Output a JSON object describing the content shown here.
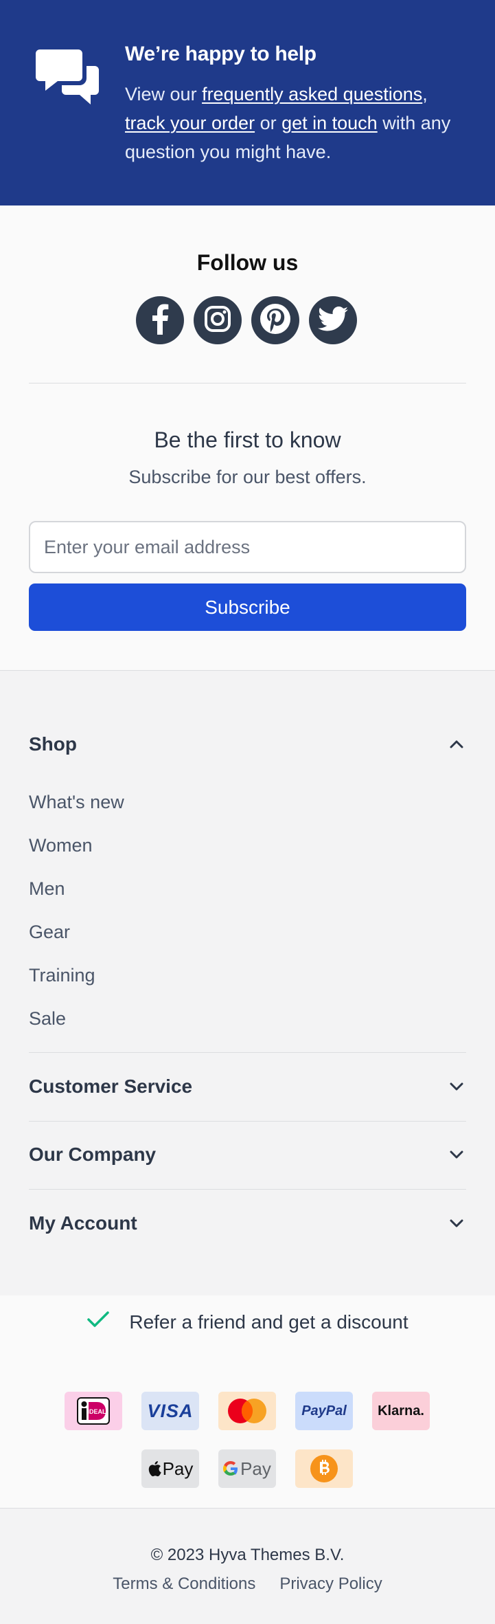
{
  "help": {
    "title": "We’re happy to help",
    "text_1": "View our ",
    "link_faq": "frequently asked questions",
    "text_2": ", ",
    "link_track": "track your order",
    "text_3": " or ",
    "link_contact": "get in touch",
    "text_4": " with any question you might have."
  },
  "follow": {
    "title": "Follow us",
    "icons": [
      "facebook-icon",
      "instagram-icon",
      "pinterest-icon",
      "twitter-icon"
    ]
  },
  "newsletter": {
    "title": "Be the first to know",
    "subtitle": "Subscribe for our best offers.",
    "email_placeholder": "Enter your email address",
    "email_value": "",
    "button": "Subscribe"
  },
  "footer_links": {
    "shop": {
      "title": "Shop",
      "expanded": true,
      "items": [
        "What's new",
        "Women",
        "Men",
        "Gear",
        "Training",
        "Sale"
      ]
    },
    "customer_service": {
      "title": "Customer Service",
      "expanded": false
    },
    "our_company": {
      "title": "Our Company",
      "expanded": false
    },
    "my_account": {
      "title": "My Account",
      "expanded": false
    }
  },
  "refer": {
    "text": "Refer a friend and get a discount"
  },
  "payments": {
    "ideal": "iDEAL",
    "visa": "VISA",
    "paypal": "PayPal",
    "klarna": "Klarna.",
    "applepay": "Pay",
    "googlepay": "Pay"
  },
  "colors": {
    "help_bg": "#1f3a8a",
    "primary": "#1d4ed8",
    "social_bg": "#2f3b4d",
    "check": "#10b981"
  },
  "legal": {
    "copyright": "© 2023 Hyva Themes B.V.",
    "terms": "Terms & Conditions",
    "privacy": "Privacy Policy"
  }
}
